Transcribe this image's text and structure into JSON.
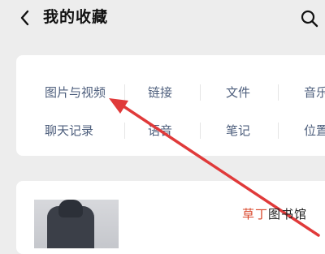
{
  "header": {
    "title": "我的收藏",
    "back_icon": "chevron-left-icon",
    "search_icon": "search-icon"
  },
  "categories": [
    {
      "label": "图片与视频"
    },
    {
      "label": "链接"
    },
    {
      "label": "文件"
    },
    {
      "label": "音乐"
    },
    {
      "label": "聊天记录"
    },
    {
      "label": "语音"
    },
    {
      "label": "笔记"
    },
    {
      "label": "位置"
    }
  ],
  "annotation": {
    "arrow_color": "#e03a3a"
  },
  "watermark": {
    "part1": "草丁",
    "part2": "图书馆"
  },
  "colors": {
    "background": "#ededed",
    "card": "#ffffff",
    "category_text": "#4d5e7c"
  }
}
